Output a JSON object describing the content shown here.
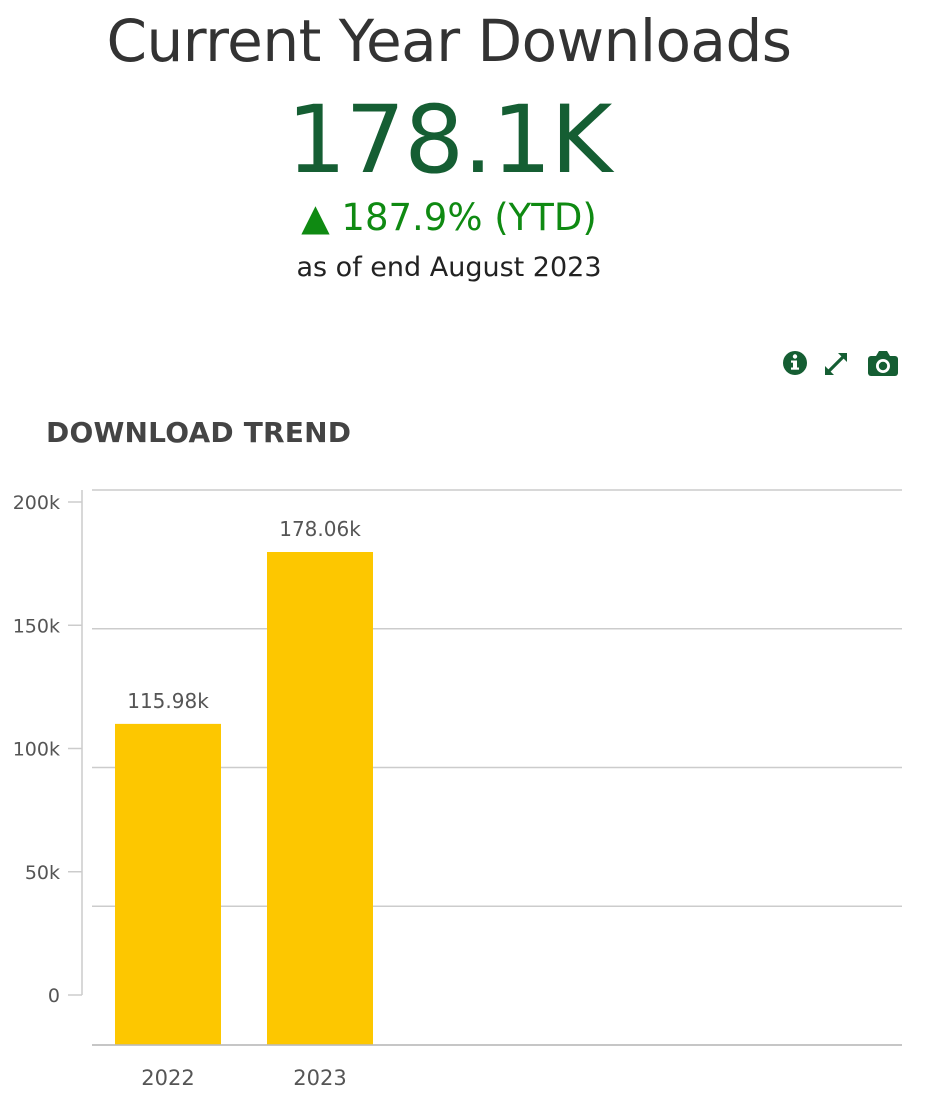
{
  "kpi": {
    "title": "Current Year Downloads",
    "value": "178.1K",
    "change": "▲ 187.9% (YTD)",
    "as_of": "as of end August 2023"
  },
  "toolbar": {
    "info_icon": "info-icon",
    "expand_icon": "expand-icon",
    "screenshot_icon": "camera-icon",
    "icon_color": "#155e33"
  },
  "section_title": "DOWNLOAD TREND",
  "colors": {
    "title": "#333333",
    "value": "#155e33",
    "change": "#0f8a12",
    "bar": "#fdc700",
    "grid": "#cccccc"
  },
  "chart_data": {
    "type": "bar",
    "categories": [
      "2022",
      "2023"
    ],
    "values": [
      115980,
      178060
    ],
    "data_labels": [
      "115.98k",
      "178.06k"
    ],
    "y_ticks": [
      0,
      50000,
      100000,
      150000,
      200000
    ],
    "y_tick_labels": [
      "0",
      "50k",
      "100k",
      "150k",
      "200k"
    ],
    "ylim": [
      0,
      200000
    ],
    "title": "DOWNLOAD TREND",
    "xlabel": "",
    "ylabel": "",
    "grid": true,
    "legend": "none"
  }
}
